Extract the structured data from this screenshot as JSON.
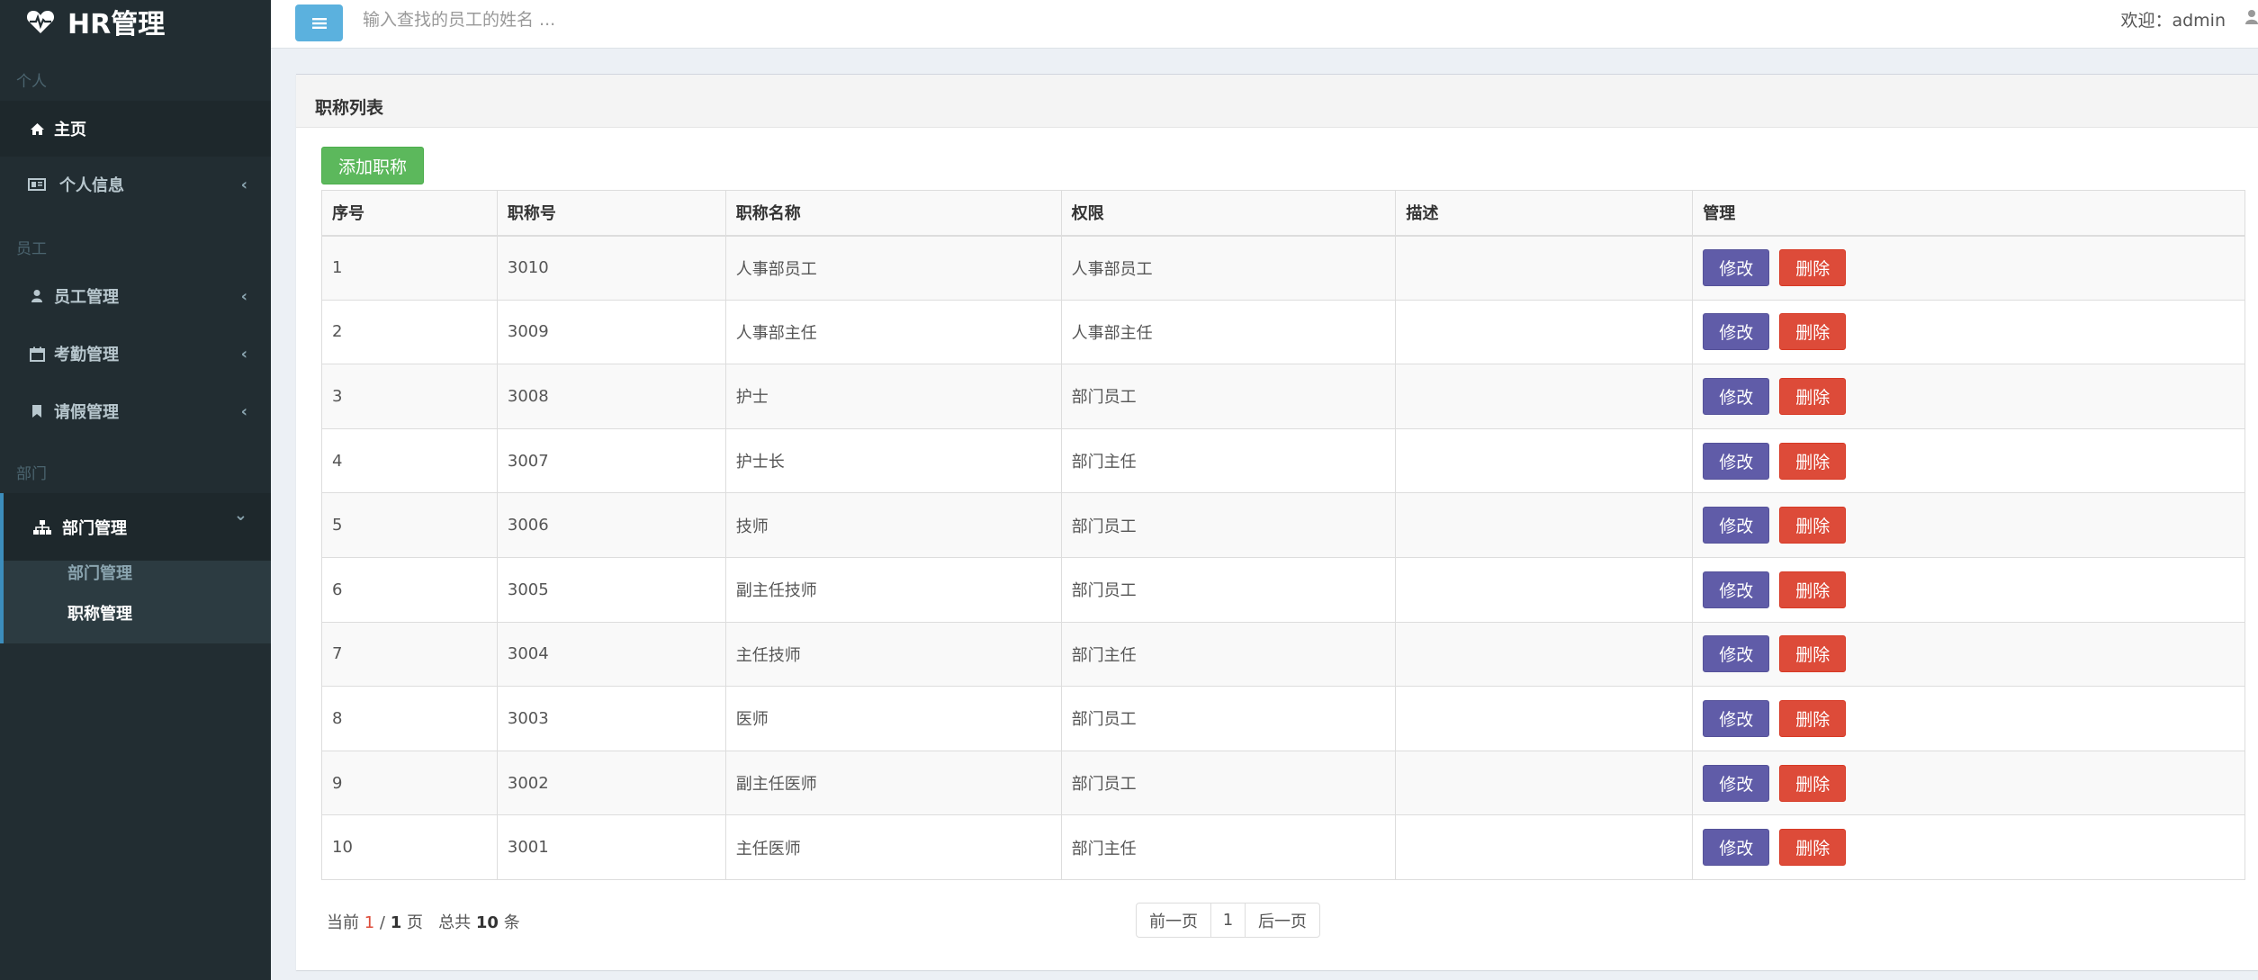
{
  "brand": {
    "title": "HR管理"
  },
  "sidebar": {
    "sections": {
      "personal": "个人",
      "employee": "员工",
      "department": "部门"
    },
    "items": [
      {
        "label": "主页",
        "icon": "home-icon"
      },
      {
        "label": "个人信息",
        "icon": "id-card-icon"
      },
      {
        "label": "员工管理",
        "icon": "user-icon"
      },
      {
        "label": "考勤管理",
        "icon": "calendar-icon"
      },
      {
        "label": "请假管理",
        "icon": "bookmark-icon"
      },
      {
        "label": "部门管理",
        "icon": "sitemap-icon"
      }
    ],
    "chevrons": {
      "left": "‹",
      "down": "⌄"
    },
    "subitems": [
      {
        "label": "部门管理"
      },
      {
        "label": "职称管理"
      }
    ]
  },
  "header": {
    "search_placeholder": "输入查找的员工的姓名 ...",
    "welcome": "欢迎：admin"
  },
  "box": {
    "title": "职称列表",
    "add_button": "添加职称"
  },
  "table": {
    "headers": [
      "序号",
      "职称号",
      "职称名称",
      "权限",
      "描述",
      "管理"
    ],
    "rows": [
      [
        "1",
        "3010",
        "人事部员工",
        "人事部员工",
        ""
      ],
      [
        "2",
        "3009",
        "人事部主任",
        "人事部主任",
        ""
      ],
      [
        "3",
        "3008",
        "护士",
        "部门员工",
        ""
      ],
      [
        "4",
        "3007",
        "护士长",
        "部门主任",
        ""
      ],
      [
        "5",
        "3006",
        "技师",
        "部门员工",
        ""
      ],
      [
        "6",
        "3005",
        "副主任技师",
        "部门员工",
        ""
      ],
      [
        "7",
        "3004",
        "主任技师",
        "部门主任",
        ""
      ],
      [
        "8",
        "3003",
        "医师",
        "部门员工",
        ""
      ],
      [
        "9",
        "3002",
        "副主任医师",
        "部门员工",
        ""
      ],
      [
        "10",
        "3001",
        "主任医师",
        "部门主任",
        ""
      ]
    ],
    "edit_label": "修改",
    "delete_label": "删除"
  },
  "pagination": {
    "current_prefix": "当前",
    "current_page": "1",
    "separator": "/",
    "total_pages": "1",
    "page_unit": "页",
    "total_prefix": "总共",
    "total_count": "10",
    "count_unit": "条",
    "prev": "前一页",
    "page_number": "1",
    "next": "后一页"
  },
  "colors": {
    "sidebar_bg": "#222d32",
    "accent_blue": "#3c8dbc",
    "add_green": "#5cb85c",
    "edit_purple": "#605ca8",
    "delete_red": "#dd4b39"
  }
}
